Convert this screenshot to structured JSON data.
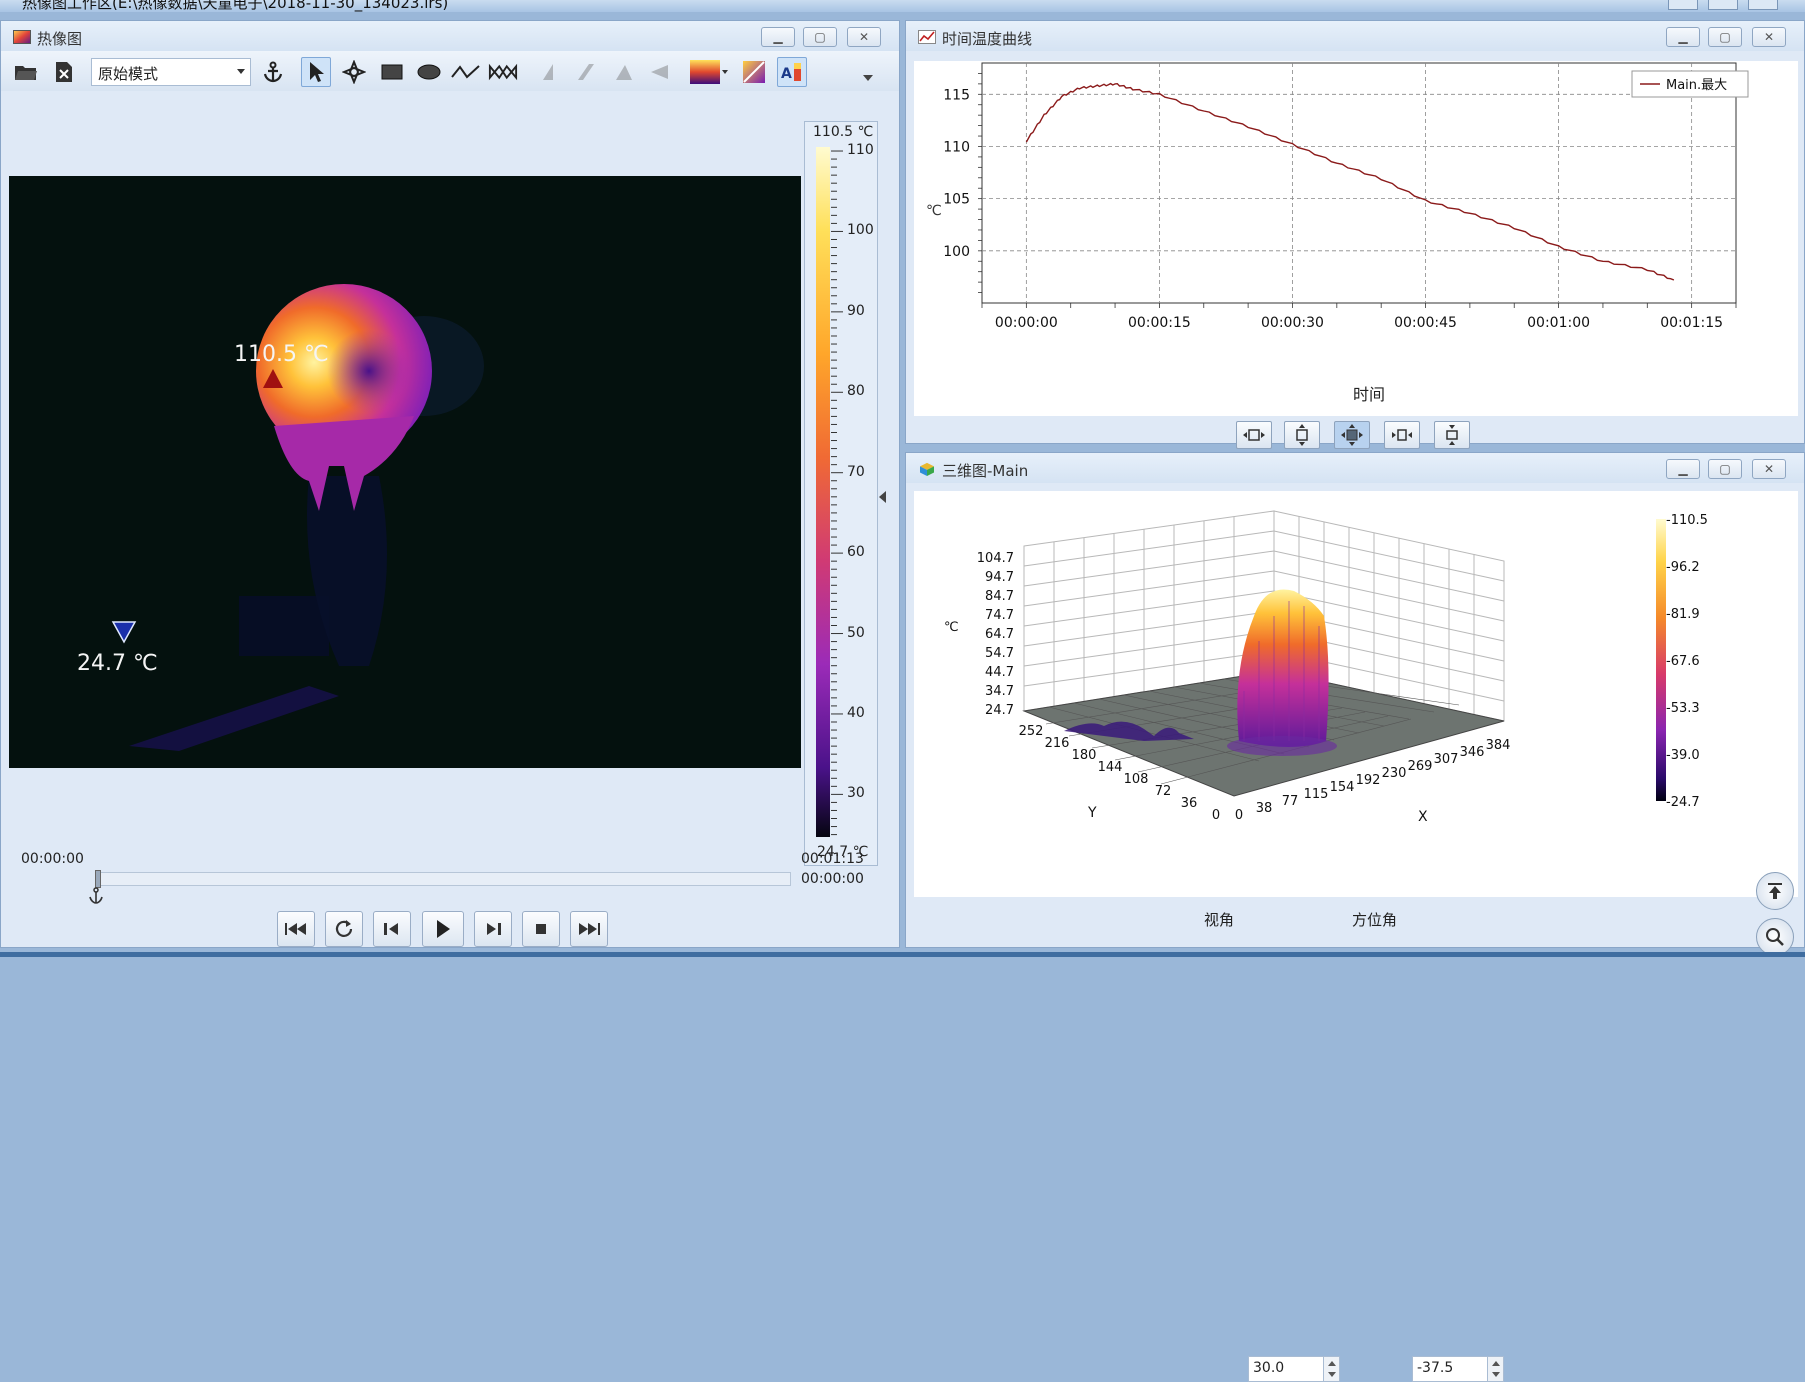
{
  "window_title": "热像图工作区(E:\\热像数据\\天童电子\\2018-11-30_134023.irs)",
  "thermal": {
    "title": "热像图",
    "mode": "原始模式",
    "max_label": "110.5 ℃",
    "min_label": "24.7 ℃",
    "scale_max": "110.5 ℃",
    "scale_min": "24.7 ℃",
    "scale_ticks": [
      "110",
      "100",
      "90",
      "80",
      "70",
      "60",
      "50",
      "40",
      "30"
    ],
    "time_start": "00:00:00",
    "time_total": "00:01:13",
    "time_current": "00:00:00"
  },
  "curve": {
    "title": "时间温度曲线",
    "legend": "Main.最大",
    "ylabel": "℃",
    "xlabel": "时间",
    "ytick_labels": [
      "115",
      "110",
      "105",
      "100"
    ],
    "xtick_labels": [
      "00:00:00",
      "00:00:15",
      "00:00:30",
      "00:00:45",
      "00:01:00",
      "00:01:15"
    ]
  },
  "chart_data": {
    "type": "line",
    "title": "",
    "xlabel": "时间",
    "ylabel": "℃",
    "xlim": [
      -5,
      80
    ],
    "ylim": [
      95,
      118
    ],
    "series": [
      {
        "name": "Main.最大",
        "x": [
          0,
          2,
          4,
          6,
          8,
          10,
          12,
          15,
          20,
          25,
          30,
          35,
          40,
          45,
          50,
          55,
          60,
          65,
          70,
          73
        ],
        "y": [
          110.5,
          113.0,
          114.8,
          115.6,
          115.8,
          116.0,
          115.5,
          115.0,
          113.4,
          111.9,
          110.2,
          108.4,
          106.9,
          104.8,
          103.6,
          102.2,
          100.4,
          99.0,
          98.2,
          97.2
        ]
      }
    ]
  },
  "plot3d": {
    "title": "三维图-Main",
    "zlabel": "℃",
    "xlabel": "X",
    "ylabel": "Y",
    "z_ticks": [
      "104.7",
      "94.7",
      "84.7",
      "74.7",
      "64.7",
      "54.7",
      "44.7",
      "34.7",
      "24.7"
    ],
    "y_ticks": [
      "252",
      "216",
      "180",
      "144",
      "108",
      "72",
      "36",
      "0"
    ],
    "x_ticks": [
      "0",
      "38",
      "77",
      "115",
      "154",
      "192",
      "230",
      "269",
      "307",
      "346",
      "384"
    ],
    "colorbar_ticks": [
      "-110.5",
      "-96.2",
      "-81.9",
      "-67.6",
      "-53.3",
      "-39.0",
      "-24.7"
    ],
    "view_angle_label": "视角",
    "view_angle_value": "30.0",
    "azimuth_label": "方位角",
    "azimuth_value": "-37.5"
  },
  "colors": {
    "line": "#8b1a1a",
    "accent": "#3d6fb4"
  }
}
